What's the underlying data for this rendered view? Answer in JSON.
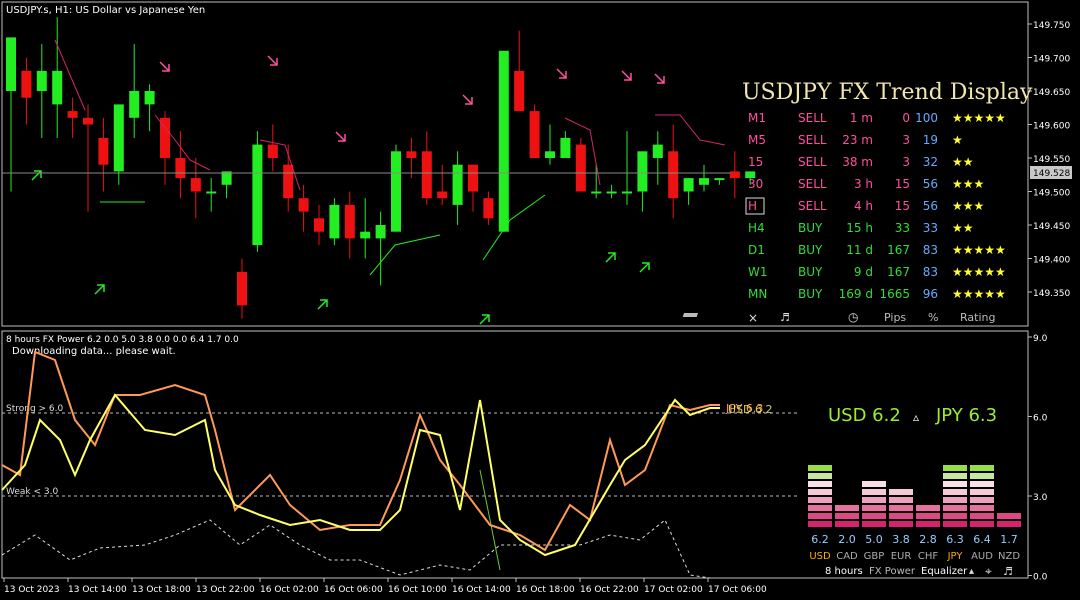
{
  "upper": {
    "title": "USDJPY.s, H1:  US Dollar vs Japanese Yen",
    "panel_title": "USDJPY FX Trend Display",
    "y_ticks": [
      "149.750",
      "149.700",
      "149.650",
      "149.600",
      "149.550",
      "149.500",
      "149.450",
      "149.400",
      "149.350"
    ],
    "price_marker": "149.528",
    "trend_rows": [
      {
        "tf": "M1",
        "dir": "SELL",
        "time": "1 m",
        "pips": "0",
        "pct": "100",
        "stars": "★★★★★",
        "color": "#ff4fa0"
      },
      {
        "tf": "M5",
        "dir": "SELL",
        "time": "23 m",
        "pips": "3",
        "pct": "19",
        "stars": "★",
        "color": "#ff4fa0"
      },
      {
        "tf": "15",
        "dir": "SELL",
        "time": "38 m",
        "pips": "3",
        "pct": "32",
        "stars": "★★",
        "color": "#ff4fa0"
      },
      {
        "tf": "30",
        "dir": "SELL",
        "time": "3 h",
        "pips": "15",
        "pct": "56",
        "stars": "★★★",
        "color": "#ff4fa0"
      },
      {
        "tf": "H",
        "dir": "SELL",
        "time": "4 h",
        "pips": "15",
        "pct": "56",
        "stars": "★★★",
        "color": "#ff4fa0"
      },
      {
        "tf": "H4",
        "dir": "BUY",
        "time": "15 h",
        "pips": "33",
        "pct": "33",
        "stars": "★★",
        "color": "#33dd33"
      },
      {
        "tf": "D1",
        "dir": "BUY",
        "time": "11 d",
        "pips": "167",
        "pct": "83",
        "stars": "★★★★★",
        "color": "#33dd33"
      },
      {
        "tf": "W1",
        "dir": "BUY",
        "time": "9 d",
        "pips": "167",
        "pct": "83",
        "stars": "★★★★★",
        "color": "#33dd33"
      },
      {
        "tf": "MN",
        "dir": "BUY",
        "time": "169 d",
        "pips": "1665",
        "pct": "96",
        "stars": "★★★★★",
        "color": "#33dd33"
      }
    ],
    "footer": {
      "close": "×",
      "music": "♬",
      "clock": "◷",
      "pips": "Pips",
      "pct": "%",
      "rating": "Rating"
    }
  },
  "lower": {
    "title": "8 hours FX Power 6.2 0.0 5.0 3.8 0.0 0.0 6.4 1.7 0.0",
    "status": "Downloading data... please wait.",
    "strong_label": "Strong > 6.0",
    "weak_label": "Weak < 3.0",
    "y_ticks": [
      "9.0",
      "6.0",
      "3.0",
      "0.0"
    ],
    "x_ticks": [
      "13 Oct 2023",
      "13 Oct 14:00",
      "13 Oct 18:00",
      "13 Oct 22:00",
      "16 Oct 02:00",
      "16 Oct 06:00",
      "16 Oct 10:00",
      "16 Oct 14:00",
      "16 Oct 18:00",
      "16 Oct 22:00",
      "17 Oct 02:00",
      "17 Oct 06:00"
    ],
    "line_labels": [
      "JPY 6.3",
      "USD 6.2"
    ],
    "summary": {
      "base": "USD 6.2",
      "sep": "▵",
      "quote": "JPY 6.3"
    },
    "equalizer": [
      {
        "ccy": "USD",
        "val": "6.2",
        "highlight": true
      },
      {
        "ccy": "CAD",
        "val": "2.0",
        "highlight": false
      },
      {
        "ccy": "GBP",
        "val": "5.0",
        "highlight": false
      },
      {
        "ccy": "EUR",
        "val": "3.8",
        "highlight": false
      },
      {
        "ccy": "CHF",
        "val": "2.8",
        "highlight": false
      },
      {
        "ccy": "JPY",
        "val": "6.3",
        "highlight": true
      },
      {
        "ccy": "AUD",
        "val": "6.4",
        "highlight": false
      },
      {
        "ccy": "NZD",
        "val": "1.7",
        "highlight": false
      }
    ],
    "eq_footer": {
      "period": "8 hours",
      "name": "FX Power",
      "mode": "Equalizer",
      "up": "▴",
      "target": "⌖",
      "music": "♬"
    }
  },
  "chart_data": [
    {
      "type": "candlestick",
      "title": "USDJPY.s, H1:  US Dollar vs Japanese Yen",
      "ylim": [
        149.31,
        149.8
      ],
      "current_price": 149.528,
      "candles": [
        {
          "o": 149.65,
          "h": 149.71,
          "l": 149.5,
          "c": 149.73
        },
        {
          "o": 149.68,
          "h": 149.7,
          "l": 149.6,
          "c": 149.64
        },
        {
          "o": 149.65,
          "h": 149.72,
          "l": 149.58,
          "c": 149.68
        },
        {
          "o": 149.63,
          "h": 149.76,
          "l": 149.58,
          "c": 149.68
        },
        {
          "o": 149.62,
          "h": 149.64,
          "l": 149.58,
          "c": 149.61
        },
        {
          "o": 149.61,
          "h": 149.63,
          "l": 149.47,
          "c": 149.6
        },
        {
          "o": 149.58,
          "h": 149.61,
          "l": 149.5,
          "c": 149.54
        },
        {
          "o": 149.53,
          "h": 149.62,
          "l": 149.51,
          "c": 149.63
        },
        {
          "o": 149.61,
          "h": 149.72,
          "l": 149.58,
          "c": 149.65
        },
        {
          "o": 149.63,
          "h": 149.66,
          "l": 149.59,
          "c": 149.65
        },
        {
          "o": 149.61,
          "h": 149.62,
          "l": 149.51,
          "c": 149.55
        },
        {
          "o": 149.55,
          "h": 149.59,
          "l": 149.49,
          "c": 149.52
        },
        {
          "o": 149.52,
          "h": 149.55,
          "l": 149.46,
          "c": 149.5
        },
        {
          "o": 149.5,
          "h": 149.52,
          "l": 149.47,
          "c": 149.5
        },
        {
          "o": 149.51,
          "h": 149.53,
          "l": 149.49,
          "c": 149.53
        },
        {
          "o": 149.38,
          "h": 149.4,
          "l": 149.31,
          "c": 149.33
        },
        {
          "o": 149.42,
          "h": 149.59,
          "l": 149.41,
          "c": 149.57
        },
        {
          "o": 149.57,
          "h": 149.6,
          "l": 149.53,
          "c": 149.55
        },
        {
          "o": 149.54,
          "h": 149.57,
          "l": 149.47,
          "c": 149.49
        },
        {
          "o": 149.49,
          "h": 149.51,
          "l": 149.44,
          "c": 149.47
        },
        {
          "o": 149.46,
          "h": 149.48,
          "l": 149.42,
          "c": 149.44
        },
        {
          "o": 149.43,
          "h": 149.49,
          "l": 149.42,
          "c": 149.48
        },
        {
          "o": 149.48,
          "h": 149.5,
          "l": 149.4,
          "c": 149.43
        },
        {
          "o": 149.43,
          "h": 149.49,
          "l": 149.4,
          "c": 149.44
        },
        {
          "o": 149.43,
          "h": 149.47,
          "l": 149.36,
          "c": 149.45
        },
        {
          "o": 149.44,
          "h": 149.57,
          "l": 149.44,
          "c": 149.56
        },
        {
          "o": 149.56,
          "h": 149.58,
          "l": 149.52,
          "c": 149.55
        },
        {
          "o": 149.56,
          "h": 149.59,
          "l": 149.48,
          "c": 149.49
        },
        {
          "o": 149.5,
          "h": 149.54,
          "l": 149.48,
          "c": 149.49
        },
        {
          "o": 149.48,
          "h": 149.56,
          "l": 149.45,
          "c": 149.54
        },
        {
          "o": 149.54,
          "h": 149.54,
          "l": 149.47,
          "c": 149.5
        },
        {
          "o": 149.49,
          "h": 149.5,
          "l": 149.45,
          "c": 149.46
        },
        {
          "o": 149.44,
          "h": 149.71,
          "l": 149.44,
          "c": 149.71
        },
        {
          "o": 149.68,
          "h": 149.74,
          "l": 149.62,
          "c": 149.62
        },
        {
          "o": 149.62,
          "h": 149.63,
          "l": 149.55,
          "c": 149.55
        },
        {
          "o": 149.55,
          "h": 149.6,
          "l": 149.54,
          "c": 149.56
        },
        {
          "o": 149.55,
          "h": 149.59,
          "l": 149.55,
          "c": 149.58
        },
        {
          "o": 149.57,
          "h": 149.58,
          "l": 149.52,
          "c": 149.5
        },
        {
          "o": 149.5,
          "h": 149.54,
          "l": 149.49,
          "c": 149.5
        },
        {
          "o": 149.5,
          "h": 149.51,
          "l": 149.49,
          "c": 149.5
        },
        {
          "o": 149.5,
          "h": 149.59,
          "l": 149.48,
          "c": 149.5
        },
        {
          "o": 149.5,
          "h": 149.53,
          "l": 149.47,
          "c": 149.56
        },
        {
          "o": 149.55,
          "h": 149.59,
          "l": 149.51,
          "c": 149.57
        },
        {
          "o": 149.56,
          "h": 149.6,
          "l": 149.46,
          "c": 149.49
        },
        {
          "o": 149.5,
          "h": 149.52,
          "l": 149.48,
          "c": 149.52
        },
        {
          "o": 149.51,
          "h": 149.54,
          "l": 149.5,
          "c": 149.52
        },
        {
          "o": 149.52,
          "h": 149.52,
          "l": 149.51,
          "c": 149.52
        },
        {
          "o": 149.53,
          "h": 149.56,
          "l": 149.49,
          "c": 149.52
        },
        {
          "o": 149.52,
          "h": 149.53,
          "l": 149.51,
          "c": 149.53
        }
      ]
    },
    {
      "type": "line",
      "title": "8 hours FX Power 6.2 0.0 5.0 3.8 0.0 0.0 6.4 1.7 0.0",
      "ylim": [
        0,
        9
      ],
      "levels": [
        {
          "name": "Strong",
          "value": 6.0
        },
        {
          "name": "Weak",
          "value": 3.0
        }
      ],
      "x": [
        "13 Oct 2023",
        "13 Oct 14:00",
        "13 Oct 18:00",
        "13 Oct 22:00",
        "16 Oct 02:00",
        "16 Oct 06:00",
        "16 Oct 10:00",
        "16 Oct 14:00",
        "16 Oct 18:00",
        "16 Oct 22:00",
        "17 Oct 02:00",
        "17 Oct 06:00"
      ],
      "series": [
        {
          "name": "USD",
          "color": "#ffff66",
          "values": [
            3.2,
            7.0,
            5.5,
            2.6,
            2.5,
            2.5,
            3.0,
            3.0,
            5.0,
            6.0,
            2.6,
            0.9,
            4.8,
            6.0,
            6.2
          ]
        },
        {
          "name": "JPY",
          "color": "#ff9955",
          "values": [
            3.0,
            9.0,
            6.8,
            3.8,
            2.5,
            1.5,
            2.8,
            3.0,
            6.0,
            5.5,
            4.0,
            1.8,
            4.5,
            6.3,
            6.3
          ]
        }
      ]
    },
    {
      "type": "bar",
      "title": "",
      "categories": [
        "USD",
        "CAD",
        "GBP",
        "EUR",
        "CHF",
        "JPY",
        "AUD",
        "NZD"
      ],
      "values": [
        6.2,
        2.0,
        5.0,
        3.8,
        2.8,
        6.3,
        6.4,
        1.7
      ],
      "ylim": [
        0,
        9
      ]
    }
  ]
}
